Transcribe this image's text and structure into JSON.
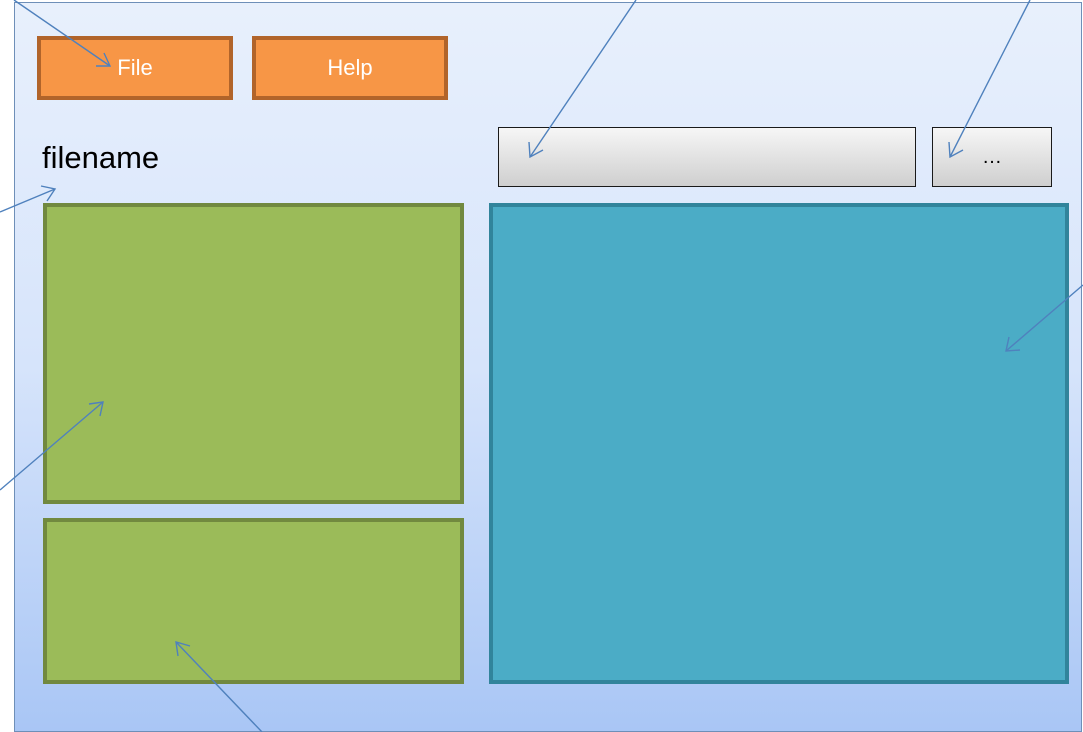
{
  "menu": {
    "file_label": "File",
    "help_label": "Help"
  },
  "file": {
    "name_label": "filename"
  },
  "path_field": {
    "value": ""
  },
  "browse": {
    "label": "…"
  },
  "colors": {
    "menu_button": "#f79646",
    "menu_button_border": "#b1642a",
    "list_panel": "#9bbb59",
    "list_panel_border": "#71893f",
    "content_panel": "#4bacc6",
    "content_panel_border": "#31849b",
    "window_top": "#e8f0fc",
    "window_bottom": "#a9c6f5",
    "callout_arrow": "#4f81bd"
  }
}
